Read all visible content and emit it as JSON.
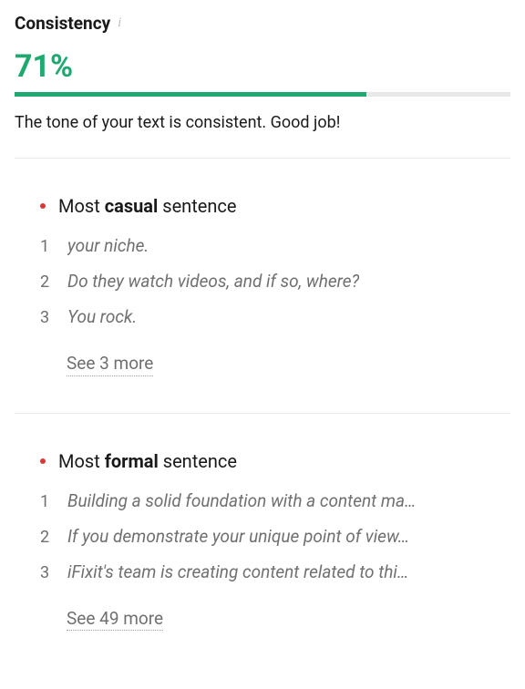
{
  "header": {
    "title": "Consistency",
    "info_icon": "i"
  },
  "score": {
    "percent_label": "71%",
    "percent_value": 71,
    "description": "The tone of your text is consistent. Good job!"
  },
  "casual": {
    "heading_prefix": "Most ",
    "heading_bold": "casual",
    "heading_suffix": " sentence",
    "items": [
      {
        "num": "1",
        "text": "your niche."
      },
      {
        "num": "2",
        "text": "Do they watch videos, and if so, where?"
      },
      {
        "num": "3",
        "text": "You rock."
      }
    ],
    "see_more": "See 3 more"
  },
  "formal": {
    "heading_prefix": "Most ",
    "heading_bold": "formal",
    "heading_suffix": " sentence",
    "items": [
      {
        "num": "1",
        "text": "Building a solid foundation with a content ma…"
      },
      {
        "num": "2",
        "text": "If you demonstrate your unique point of view…"
      },
      {
        "num": "3",
        "text": "iFixit's team is creating content related to thi…"
      }
    ],
    "see_more": "See 49 more"
  },
  "colors": {
    "accent": "#1fa971",
    "dot": "#d53a3a"
  }
}
